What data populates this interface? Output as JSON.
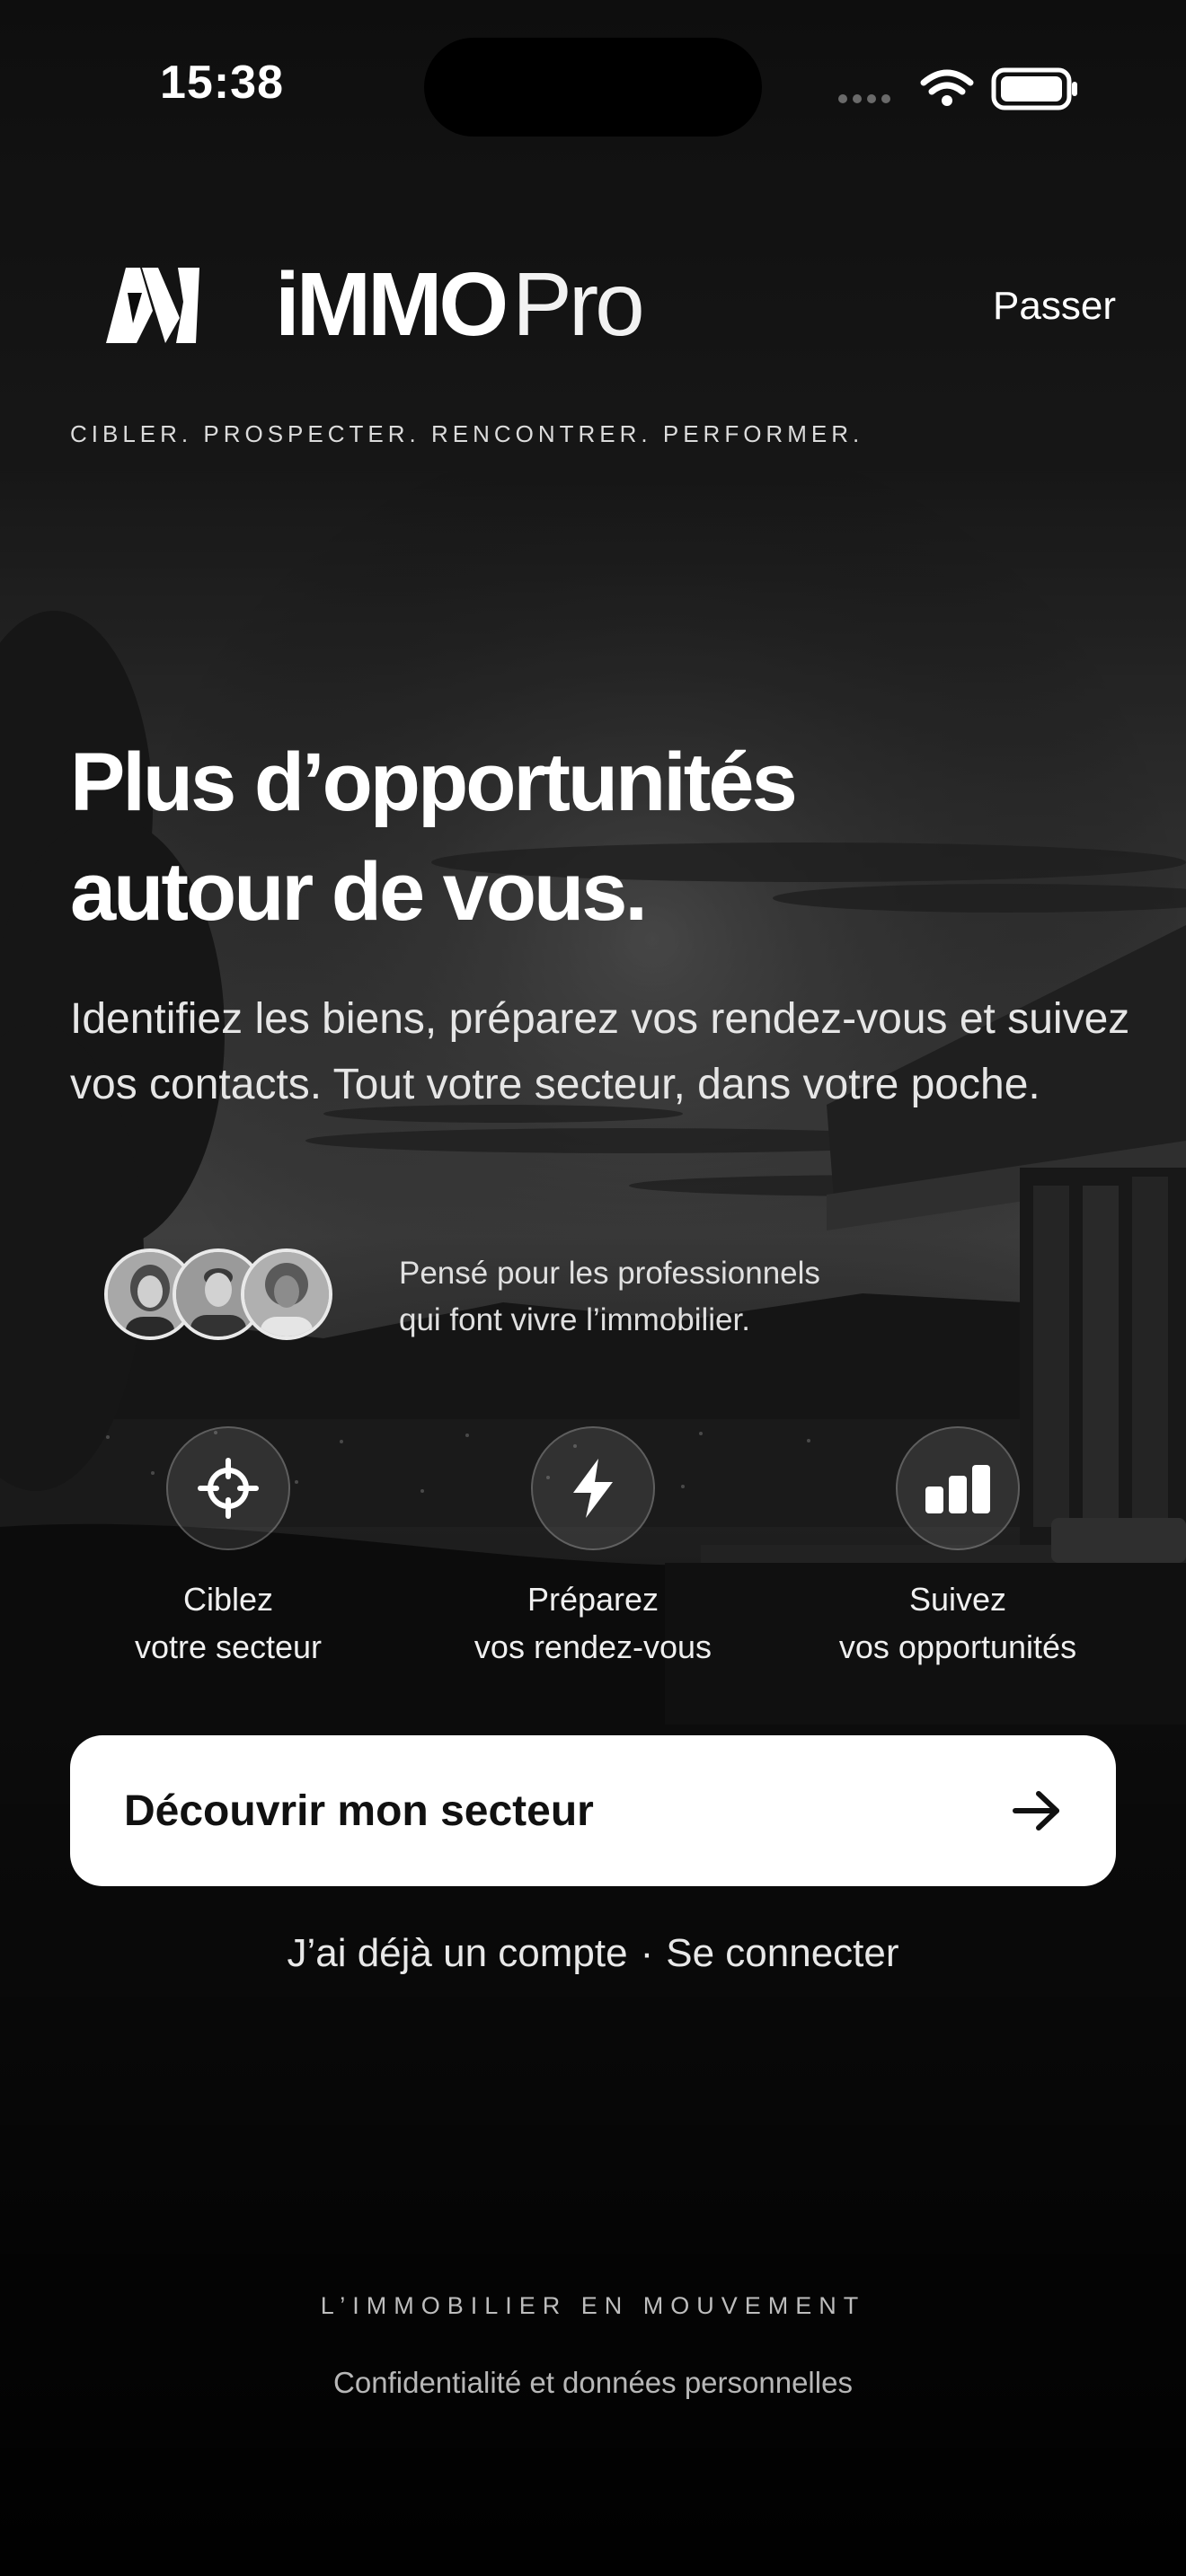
{
  "status_bar": {
    "time": "15:38"
  },
  "header": {
    "brand_bold": "iMMO",
    "brand_light": "Pro",
    "skip_label": "Passer",
    "tagline": "CIBLER. PROSPECTER. RENCONTRER. PERFORMER."
  },
  "hero": {
    "headline_line1": "Plus d’opportunités",
    "headline_line2": "autour de vous.",
    "subtitle": "Identifiez les biens, préparez vos rendez-vous et suivez vos contacts. Tout votre secteur, dans votre poche."
  },
  "social_proof": {
    "line1": "Pensé pour les professionnels",
    "line2": "qui font vivre l’immobilier."
  },
  "features": [
    {
      "icon": "crosshair-icon",
      "line1": "Ciblez",
      "line2": "votre secteur"
    },
    {
      "icon": "lightning-icon",
      "line1": "Préparez",
      "line2": "vos rendez-vous"
    },
    {
      "icon": "bar-chart-icon",
      "line1": "Suivez",
      "line2": "vos opportunités"
    }
  ],
  "cta": {
    "label": "Découvrir mon secteur"
  },
  "login": {
    "prefix": "J’ai déjà un compte",
    "separator": "·",
    "link": "Se connecter"
  },
  "footer": {
    "tagline": "L’IMMOBILIER EN MOUVEMENT",
    "privacy": "Confidentialité et données personnelles"
  },
  "colors": {
    "background": "#0b0b0b",
    "cta_background": "#ffffff",
    "cta_text": "#111111"
  }
}
